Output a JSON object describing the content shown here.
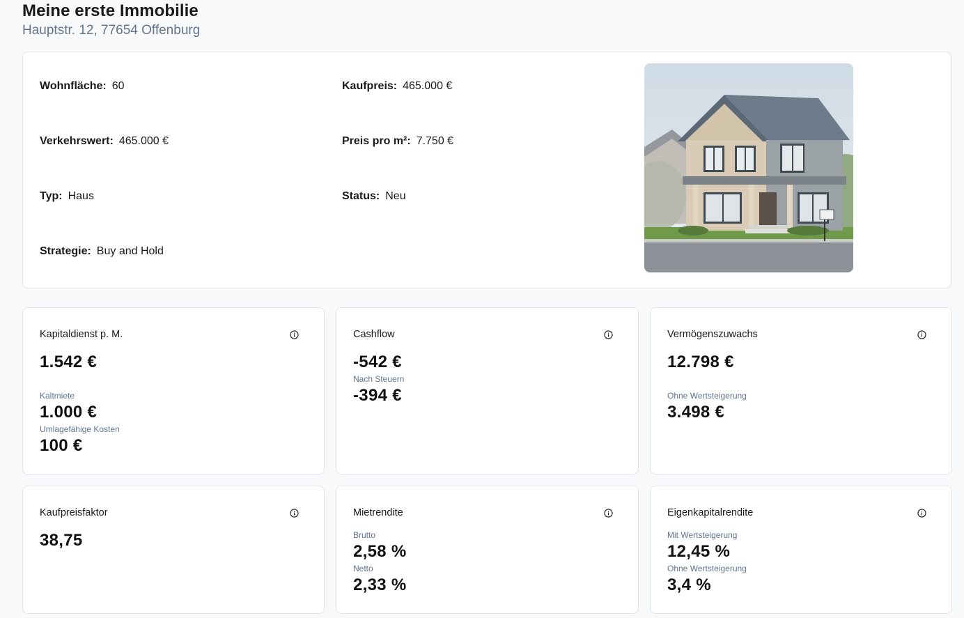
{
  "header": {
    "title": "Meine erste Immobilie",
    "address": "Hauptstr. 12, 77654 Offenburg"
  },
  "property": {
    "wohnflaeche_label": "Wohnfläche:",
    "wohnflaeche_value": "60",
    "kaufpreis_label": "Kaufpreis:",
    "kaufpreis_value": "465.000 €",
    "verkehrswert_label": "Verkehrswert:",
    "verkehrswert_value": "465.000 €",
    "preis_qm_label": "Preis pro m²:",
    "preis_qm_value": "7.750 €",
    "typ_label": "Typ:",
    "typ_value": "Haus",
    "status_label": "Status:",
    "status_value": "Neu",
    "strategie_label": "Strategie:",
    "strategie_value": "Buy and Hold"
  },
  "kpis": {
    "kapitaldienst": {
      "title": "Kapitaldienst p. M.",
      "value": "1.542 €",
      "kaltmiete_label": "Kaltmiete",
      "kaltmiete_value": "1.000 €",
      "umlage_label": "Umlagefähige Kosten",
      "umlage_value": "100 €"
    },
    "cashflow": {
      "title": "Cashflow",
      "value": "-542 €",
      "nach_steuern_label": "Nach Steuern",
      "nach_steuern_value": "-394 €"
    },
    "vermoegen": {
      "title": "Vermögenszuwachs",
      "value": "12.798 €",
      "ohne_label": "Ohne Wertsteigerung",
      "ohne_value": "3.498 €"
    },
    "kaufpreisfaktor": {
      "title": "Kaufpreisfaktor",
      "value": "38,75"
    },
    "mietrendite": {
      "title": "Mietrendite",
      "brutto_label": "Brutto",
      "brutto_value": "2,58 %",
      "netto_label": "Netto",
      "netto_value": "2,33 %"
    },
    "ekrendite": {
      "title": "Eigenkapitalrendite",
      "mit_label": "Mit Wertsteigerung",
      "mit_value": "12,45 %",
      "ohne_label": "Ohne Wertsteigerung",
      "ohne_value": "3,4 %"
    }
  },
  "icons": {
    "info": "info-circle-icon"
  }
}
